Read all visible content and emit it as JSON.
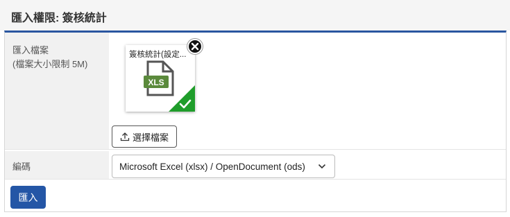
{
  "header": {
    "title": "匯入權限: 簽核統計"
  },
  "form": {
    "file_label": "匯入檔案",
    "file_hint": "(檔案大小限制 5M)",
    "file_name": "簽核統計(設定...",
    "file_type": "XLS",
    "choose_label": "選擇檔案",
    "encoding_label": "編碼",
    "encoding_value": "Microsoft Excel (xlsx) / OpenDocument (ods)"
  },
  "actions": {
    "import_label": "匯入"
  },
  "colors": {
    "accent": "#2456a6",
    "success": "#1f9d2b",
    "file_icon": "#5b8a3c"
  }
}
